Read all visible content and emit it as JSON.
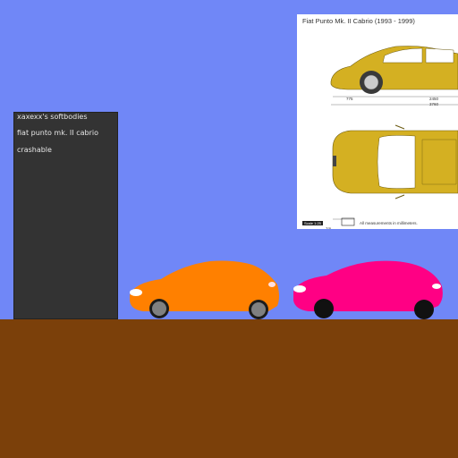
{
  "panel": {
    "line1": "xaxexx's softbodies",
    "line2": "fiat punto mk. II cabrio",
    "line3": "crashable"
  },
  "blueprint": {
    "title": "Fiat Punto Mk. II Cabrio (1993 - 1999)",
    "dim_front": "775",
    "dim_wheelbase": "2450",
    "dim_length": "3760",
    "scale": "Scale 1:25",
    "note": "All measurements in millimeters.",
    "scale_1m": "1m"
  },
  "colors": {
    "sky": "#7087f7",
    "ground": "#7b400a",
    "car_orange": "#ff8000",
    "car_pink": "#ff0084",
    "blueprint_car": "#d4b022"
  },
  "cars": [
    {
      "name": "orange-car",
      "color": "#ff8000"
    },
    {
      "name": "pink-car",
      "color": "#ff0084"
    }
  ]
}
